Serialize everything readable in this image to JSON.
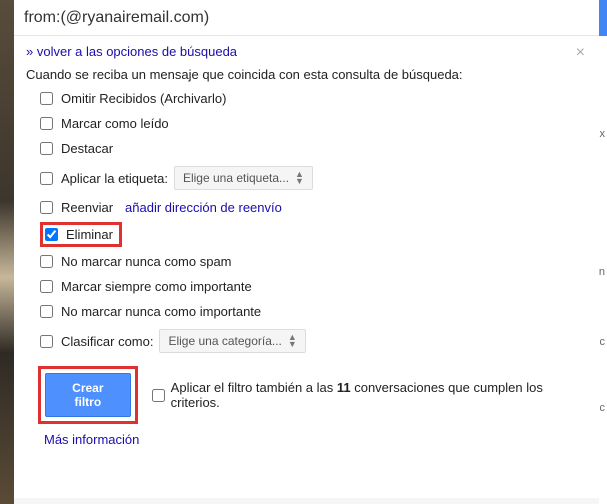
{
  "search": {
    "query": "from:(@ryanairemail.com)"
  },
  "backLink": "» volver a las opciones de búsqueda",
  "closeGlyph": "×",
  "description": "Cuando se reciba un mensaje que coincida con esta consulta de búsqueda:",
  "options": {
    "skipInbox": "Omitir Recibidos (Archivarlo)",
    "markRead": "Marcar como leído",
    "star": "Destacar",
    "applyLabel": "Aplicar la etiqueta:",
    "labelSelect": "Elige una etiqueta...",
    "forward": "Reenviar",
    "forwardLink": "añadir dirección de reenvío",
    "delete": "Eliminar",
    "neverSpam": "No marcar nunca como spam",
    "alwaysImportant": "Marcar siempre como importante",
    "neverImportant": "No marcar nunca como importante",
    "categorize": "Clasificar como:",
    "categorySelect": "Elige una categoría..."
  },
  "footer": {
    "createButton": "Crear filtro",
    "applyAlsoPre": "Aplicar el filtro también a las ",
    "applyAlsoCount": "11",
    "applyAlsoPost": " conversaciones que cumplen los criterios.",
    "moreInfo": "Más información"
  },
  "edgeLetters": {
    "a": "x",
    "b": "n",
    "c": "c",
    "d": "c"
  }
}
